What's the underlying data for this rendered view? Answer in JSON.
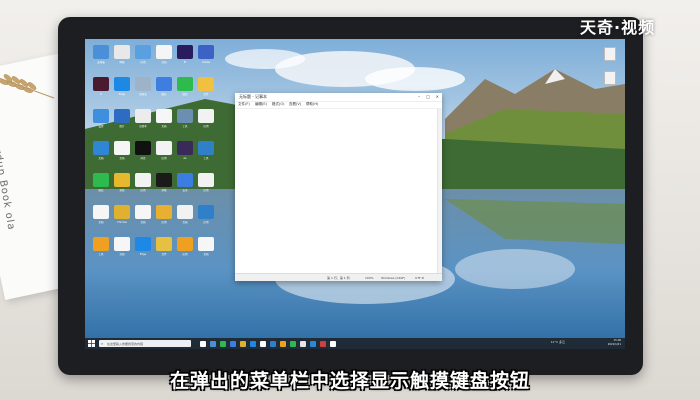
{
  "watermark": {
    "logo_text": "天奇·视频"
  },
  "caption": {
    "text": "在弹出的菜单栏中选择显示触摸键盘按钮"
  },
  "background_note": {
    "text": "Pardup Book ola"
  },
  "desktop": {
    "icons": [
      {
        "label": "此电脑",
        "color": "#4a90d9"
      },
      {
        "label": "网络",
        "color": "#e8e8e8"
      },
      {
        "label": "应用",
        "color": "#5aa0e0"
      },
      {
        "label": "文档",
        "color": "#f5f5f5"
      },
      {
        "label": "Pr",
        "color": "#2a1a5e"
      },
      {
        "label": "Adobe",
        "color": "#3b62c4"
      },
      {
        "label": "In",
        "color": "#4a1a2e"
      },
      {
        "label": "Edge",
        "color": "#1e88e5"
      },
      {
        "label": "回收站",
        "color": "#9fb3c8"
      },
      {
        "label": "图标",
        "color": "#3d7ee0"
      },
      {
        "label": "微信",
        "color": "#2dbb4e"
      },
      {
        "label": "文件",
        "color": "#f0c040"
      },
      {
        "label": "设置",
        "color": "#3f8fe0"
      },
      {
        "label": "照片",
        "color": "#2e6cc4"
      },
      {
        "label": "记事本",
        "color": "#ececec"
      },
      {
        "label": "文档",
        "color": "#f6f6f6"
      },
      {
        "label": "工具",
        "color": "#6a8fb0"
      },
      {
        "label": "应用",
        "color": "#f2f2f2"
      },
      {
        "label": "文档",
        "color": "#2f86d7"
      },
      {
        "label": "文档",
        "color": "#f6f6f6"
      },
      {
        "label": "抖音",
        "color": "#111111"
      },
      {
        "label": "应用",
        "color": "#f3f3f3"
      },
      {
        "label": "Ae",
        "color": "#3a2a5a"
      },
      {
        "label": "工具",
        "color": "#2f80c8"
      },
      {
        "label": "微信",
        "color": "#2dbb4e"
      },
      {
        "label": "游戏",
        "color": "#e6b82e"
      },
      {
        "label": "应用",
        "color": "#f2f2f2"
      },
      {
        "label": "剪映",
        "color": "#1a1a1a"
      },
      {
        "label": "安全",
        "color": "#3b7de0"
      },
      {
        "label": "应用",
        "color": "#f2f2f2"
      },
      {
        "label": "文档",
        "color": "#f6f6f6"
      },
      {
        "label": "Chrome",
        "color": "#e0b030"
      },
      {
        "label": "文档",
        "color": "#f6f6f6"
      },
      {
        "label": "应用",
        "color": "#e8b030"
      },
      {
        "label": "文档",
        "color": "#f2f2f2"
      },
      {
        "label": "应用",
        "color": "#2f80c8"
      },
      {
        "label": "工具",
        "color": "#f0a020"
      },
      {
        "label": "文档",
        "color": "#f6f6f6"
      },
      {
        "label": "Edge",
        "color": "#1e88e5"
      },
      {
        "label": "文件",
        "color": "#e6c040"
      },
      {
        "label": "应用",
        "color": "#f0a020"
      },
      {
        "label": "文档",
        "color": "#f6f6f6"
      }
    ]
  },
  "notepad": {
    "title": "无标题 - 记事本",
    "menu": [
      "文件(F)",
      "编辑(E)",
      "格式(O)",
      "查看(V)",
      "帮助(H)"
    ],
    "status": {
      "position": "第 1 行，第 1 列",
      "zoom": "100%",
      "line_ending": "Windows (CRLF)",
      "encoding": "UTF-8"
    }
  },
  "taskbar": {
    "search_placeholder": "在这里输入你要搜索的内容",
    "weather": "12°C 多云",
    "time": "15:00",
    "date": "2021/1/21",
    "app_colors": [
      "#ffffff",
      "#4a90d9",
      "#2dbb4e",
      "#3b7de0",
      "#e0b030",
      "#1e88e5",
      "#ffffff",
      "#2f80c8",
      "#f0a020",
      "#2dbb4e",
      "#e6e6e6",
      "#2f86d7",
      "#d04040",
      "#ffffff"
    ]
  },
  "colors": {
    "taskbar": "#1f2b37",
    "monitor_bezel": "#1d1e21"
  }
}
